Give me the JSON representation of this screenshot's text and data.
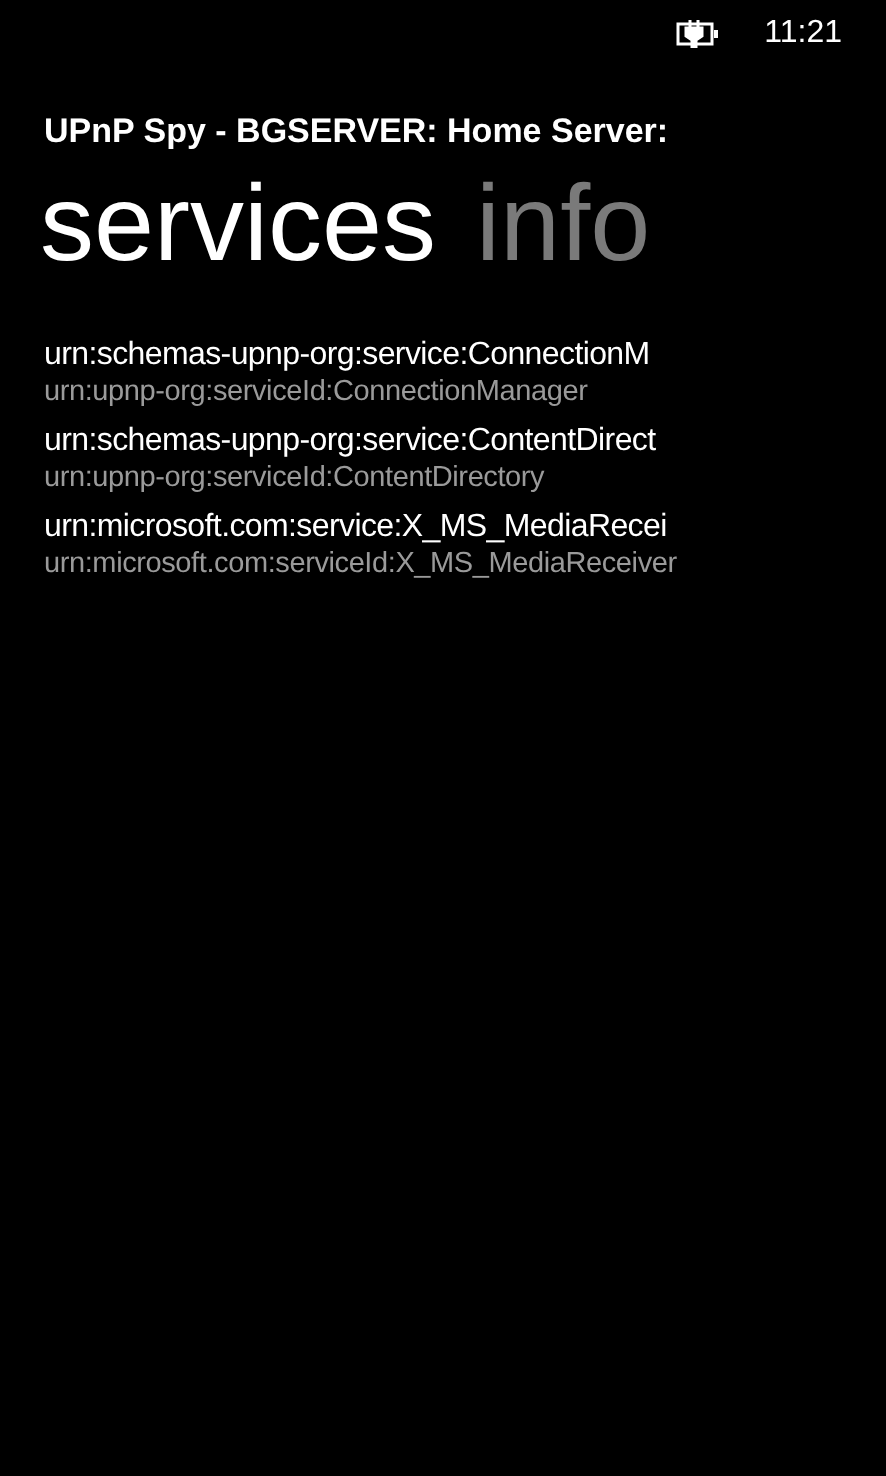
{
  "status_bar": {
    "time": "11:21"
  },
  "app_title": "UPnP Spy - BGSERVER: Home Server:",
  "pivots": [
    {
      "label": "services",
      "selected": true
    },
    {
      "label": "info",
      "selected": false
    }
  ],
  "services": [
    {
      "type": "urn:schemas-upnp-org:service:ConnectionM",
      "id": "urn:upnp-org:serviceId:ConnectionManager"
    },
    {
      "type": "urn:schemas-upnp-org:service:ContentDirect",
      "id": "urn:upnp-org:serviceId:ContentDirectory"
    },
    {
      "type": "urn:microsoft.com:service:X_MS_MediaRecei",
      "id": "urn:microsoft.com:serviceId:X_MS_MediaReceiver"
    }
  ]
}
